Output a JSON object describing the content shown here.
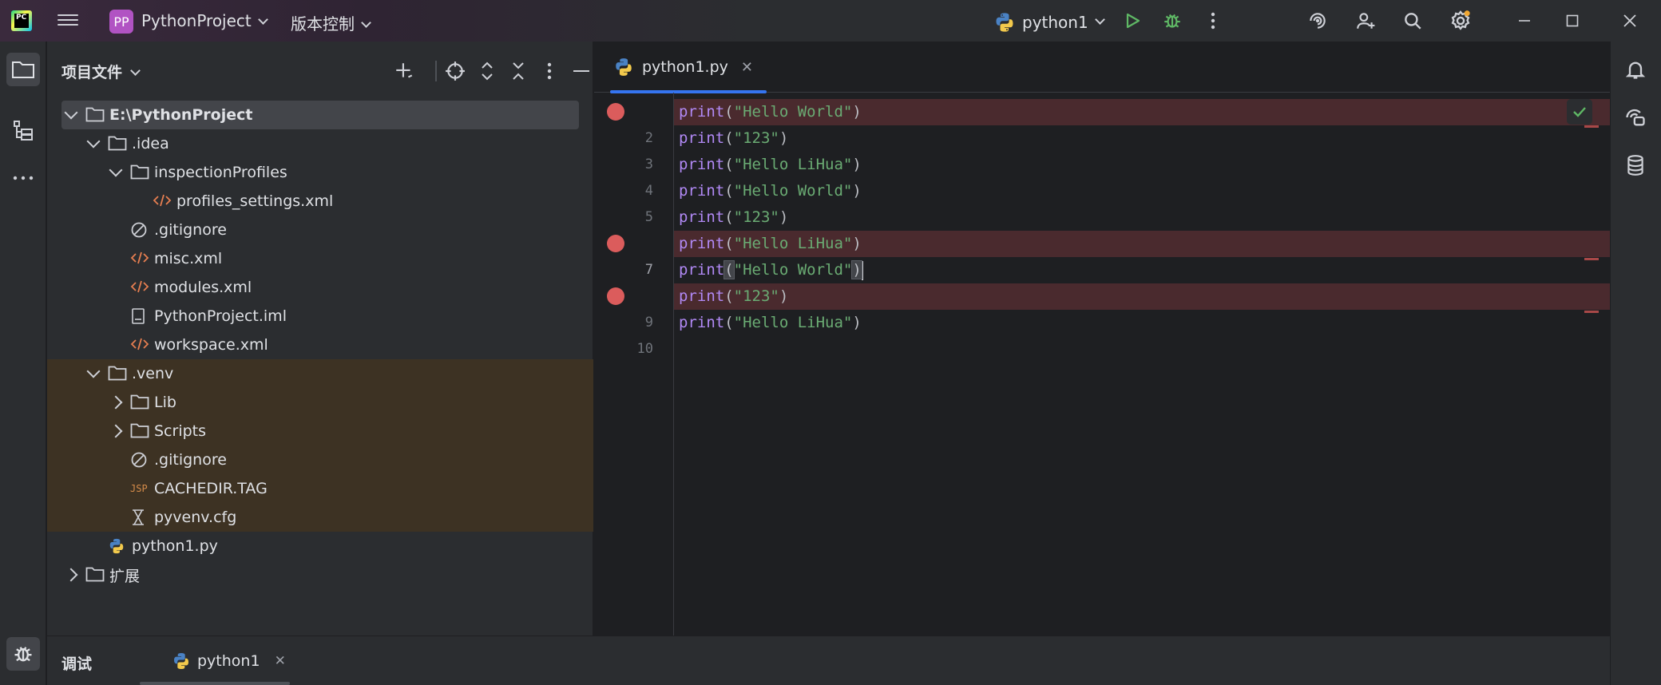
{
  "titlebar": {
    "app_logo_text": "PC",
    "project_badge": "PP",
    "project_name": "PythonProject",
    "vcs_label": "版本控制",
    "run_config": "python1"
  },
  "project_panel": {
    "title": "项目文件",
    "tree": [
      {
        "label": "E:\\PythonProject",
        "type": "folder",
        "expanded": true,
        "selected": true
      },
      {
        "label": ".idea",
        "type": "folder",
        "expanded": true
      },
      {
        "label": "inspectionProfiles",
        "type": "folder",
        "expanded": true
      },
      {
        "label": "profiles_settings.xml",
        "type": "xml"
      },
      {
        "label": ".gitignore",
        "type": "ignore"
      },
      {
        "label": "misc.xml",
        "type": "xml"
      },
      {
        "label": "modules.xml",
        "type": "xml"
      },
      {
        "label": "PythonProject.iml",
        "type": "iml"
      },
      {
        "label": "workspace.xml",
        "type": "xml"
      },
      {
        "label": ".venv",
        "type": "folder",
        "expanded": true,
        "excluded": true
      },
      {
        "label": "Lib",
        "type": "folder",
        "expanded": false,
        "excluded": true
      },
      {
        "label": "Scripts",
        "type": "folder",
        "expanded": false,
        "excluded": true
      },
      {
        "label": ".gitignore",
        "type": "ignore",
        "excluded": true
      },
      {
        "label": "CACHEDIR.TAG",
        "type": "tag",
        "excluded": true
      },
      {
        "label": "pyvenv.cfg",
        "type": "cfg",
        "excluded": true
      },
      {
        "label": "python1.py",
        "type": "python"
      },
      {
        "label": "扩展",
        "type": "folder",
        "expanded": false
      }
    ]
  },
  "editor": {
    "tab_label": "python1.py",
    "current_line": 7,
    "lines": [
      {
        "n": "",
        "keyword": "print",
        "string": "\"Hello World\"",
        "breakpoint": true
      },
      {
        "n": "2",
        "keyword": "print",
        "string": "\"123\"",
        "breakpoint": false
      },
      {
        "n": "3",
        "keyword": "print",
        "string": "\"Hello LiHua\"",
        "breakpoint": false
      },
      {
        "n": "4",
        "keyword": "print",
        "string": "\"Hello World\"",
        "breakpoint": false
      },
      {
        "n": "5",
        "keyword": "print",
        "string": "\"123\"",
        "breakpoint": false
      },
      {
        "n": "",
        "keyword": "print",
        "string": "\"Hello LiHua\"",
        "breakpoint": true
      },
      {
        "n": "7",
        "keyword": "print",
        "string": "\"Hello World\"",
        "breakpoint": false
      },
      {
        "n": "",
        "keyword": "print",
        "string": "\"123\"",
        "breakpoint": true
      },
      {
        "n": "9",
        "keyword": "print",
        "string": "\"Hello LiHua\"",
        "breakpoint": false
      },
      {
        "n": "10",
        "keyword": "",
        "string": "",
        "breakpoint": false
      }
    ]
  },
  "bottom": {
    "title": "调试",
    "tab_label": "python1"
  },
  "colors": {
    "accent": "#3574f0",
    "breakpoint": "#db5c5c",
    "run_green": "#5fb865",
    "keyword": "#b189f5",
    "string": "#6aab73",
    "excluded_bg": "#3d3223"
  }
}
